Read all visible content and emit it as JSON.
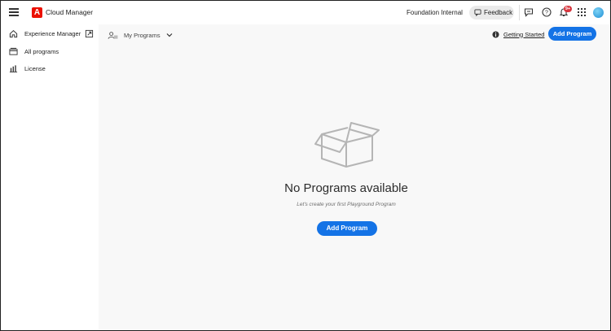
{
  "header": {
    "app_name": "Cloud Manager",
    "org_name": "Foundation Internal",
    "feedback_label": "Feedback",
    "notification_badge": "9+",
    "brand_color": "#eb1000",
    "icons": [
      "menu-icon",
      "adobe-logo-icon",
      "feedback-icon",
      "chat-icon",
      "help-icon",
      "bell-icon",
      "apps-grid-icon",
      "avatar"
    ]
  },
  "sidebar": {
    "items": [
      {
        "label": "Experience Manager",
        "icon": "home-icon"
      },
      {
        "label": "All programs",
        "icon": "programs-icon"
      },
      {
        "label": "License",
        "icon": "license-icon"
      }
    ]
  },
  "main": {
    "breadcrumb": "My Programs",
    "getting_started": "Getting Started",
    "add_program_label": "Add Program",
    "empty_title": "No Programs available",
    "empty_subtitle": "Let's create your first Playground Program",
    "empty_button_label": "Add Program",
    "accent_color": "#1473e6"
  }
}
